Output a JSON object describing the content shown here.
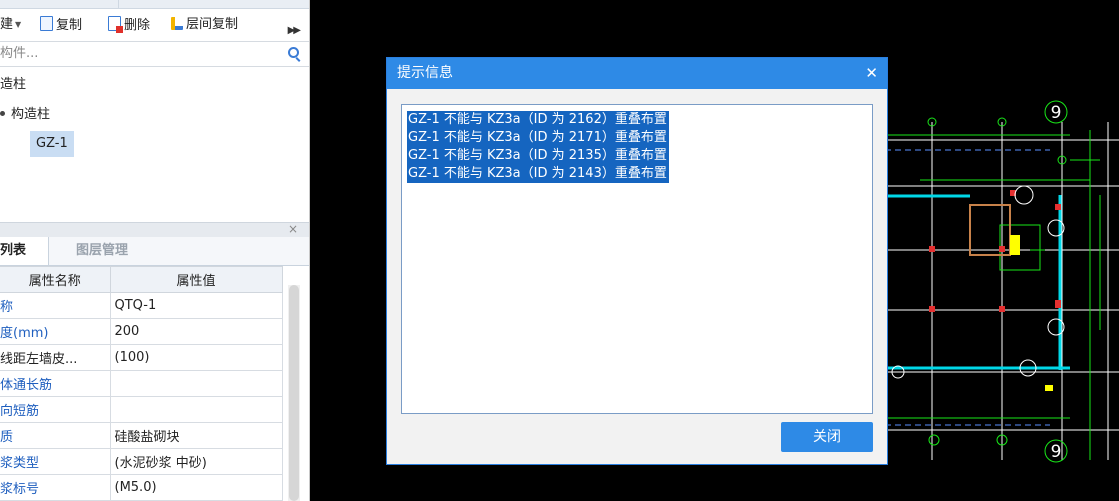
{
  "toolbar": {
    "new_label": "建",
    "copy_label": "复制",
    "delete_label": "删除",
    "floor_copy_label": "层间复制"
  },
  "search": {
    "placeholder": "构件..."
  },
  "tree": {
    "root": "造柱",
    "child": "构造柱",
    "leaf": "GZ-1"
  },
  "property_panel": {
    "tabs": [
      "列表",
      "图层管理"
    ],
    "headers": [
      "属性名称",
      "属性值"
    ],
    "rows": [
      {
        "name": "称",
        "value": "QTQ-1",
        "name_color": "blue"
      },
      {
        "name": "度(mm)",
        "value": "200",
        "name_color": "blue"
      },
      {
        "name": "线距左墙皮...",
        "value": "(100)",
        "name_color": "black"
      },
      {
        "name": "体通长筋",
        "value": "",
        "name_color": "blue"
      },
      {
        "name": "向短筋",
        "value": "",
        "name_color": "blue"
      },
      {
        "name": "质",
        "value": "硅酸盐砌块",
        "name_color": "blue"
      },
      {
        "name": "浆类型",
        "value": "(水泥砂浆 中砂)",
        "name_color": "blue"
      },
      {
        "name": "浆标号",
        "value": "(M5.0)",
        "name_color": "blue"
      }
    ]
  },
  "dialog": {
    "title": "提示信息",
    "messages": [
      "GZ-1 不能与 KZ3a（ID 为 2162）重叠布置",
      "GZ-1 不能与 KZ3a（ID 为 2171）重叠布置",
      "GZ-1 不能与 KZ3a（ID 为 2135）重叠布置",
      "GZ-1 不能与 KZ3a（ID 为 2143）重叠布置"
    ],
    "close_label": "关闭"
  },
  "cad": {
    "axis_labels": [
      "9",
      "9"
    ],
    "colors": {
      "background": "#000000",
      "grid": "#ffffff",
      "column": "#e53030",
      "wall": "#00d8e8",
      "line": "#19e619",
      "accent": "#ffff00"
    }
  },
  "colors": {
    "accent": "#2e8ae6",
    "selection": "#1565c0",
    "tree_selected": "#c9ddf3",
    "link_text": "#1f5fbf"
  }
}
